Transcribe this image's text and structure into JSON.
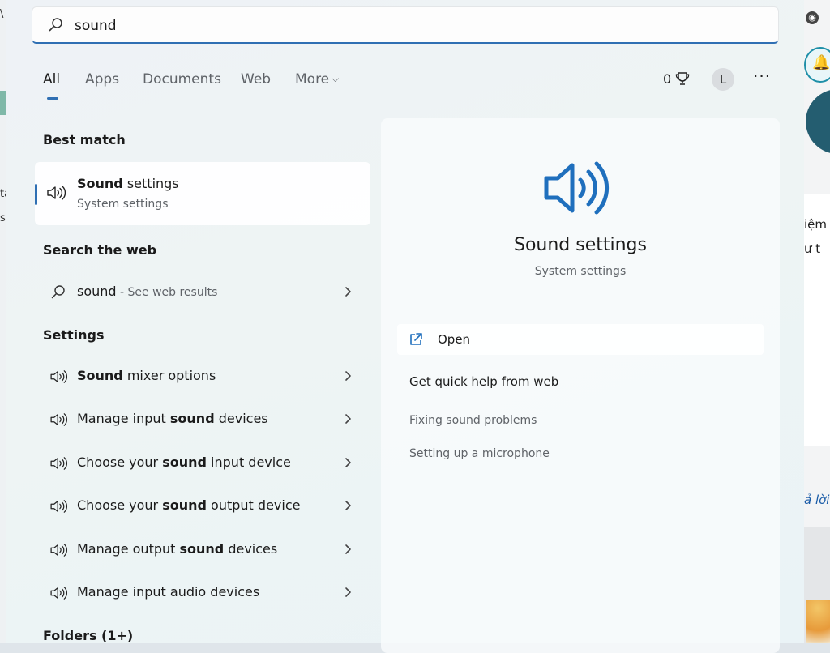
{
  "search": {
    "query": "sound",
    "icon": "search-icon"
  },
  "tabs": [
    {
      "label": "All",
      "active": true
    },
    {
      "label": "Apps"
    },
    {
      "label": "Documents"
    },
    {
      "label": "Web"
    },
    {
      "label": "More"
    }
  ],
  "toolbar": {
    "points": "0",
    "avatar_initial": "L",
    "more_options": "···"
  },
  "best_match": {
    "heading": "Best match",
    "title_bold": "Sound",
    "title_rest": " settings",
    "subtitle": "System settings"
  },
  "web": {
    "heading": "Search the web",
    "query": "sound",
    "hint": " - See web results"
  },
  "settings": {
    "heading": "Settings",
    "items": [
      {
        "pre": "",
        "bold": "Sound",
        "post": " mixer options"
      },
      {
        "pre": "Manage input ",
        "bold": "sound",
        "post": " devices"
      },
      {
        "pre": "Choose your ",
        "bold": "sound",
        "post": " input device"
      },
      {
        "pre": "Choose your ",
        "bold": "sound",
        "post": " output device"
      },
      {
        "pre": "Manage output ",
        "bold": "sound",
        "post": " devices"
      },
      {
        "pre": "Manage input audio devices",
        "bold": "",
        "post": ""
      }
    ]
  },
  "folders": {
    "heading": "Folders (1+)"
  },
  "preview": {
    "title": "Sound settings",
    "subtitle": "System settings",
    "open_label": "Open",
    "quick_help": "Get quick help from web",
    "links": [
      "Fixing sound problems",
      "Setting up a microphone"
    ]
  },
  "background": {
    "left_fragments": [
      "\\",
      "ta",
      "s"
    ],
    "right_fragments": [
      "iệm",
      "ư t",
      "ả lời"
    ]
  },
  "colors": {
    "accent": "#2f6fb3",
    "speaker_blue": "#1f6fbd"
  }
}
